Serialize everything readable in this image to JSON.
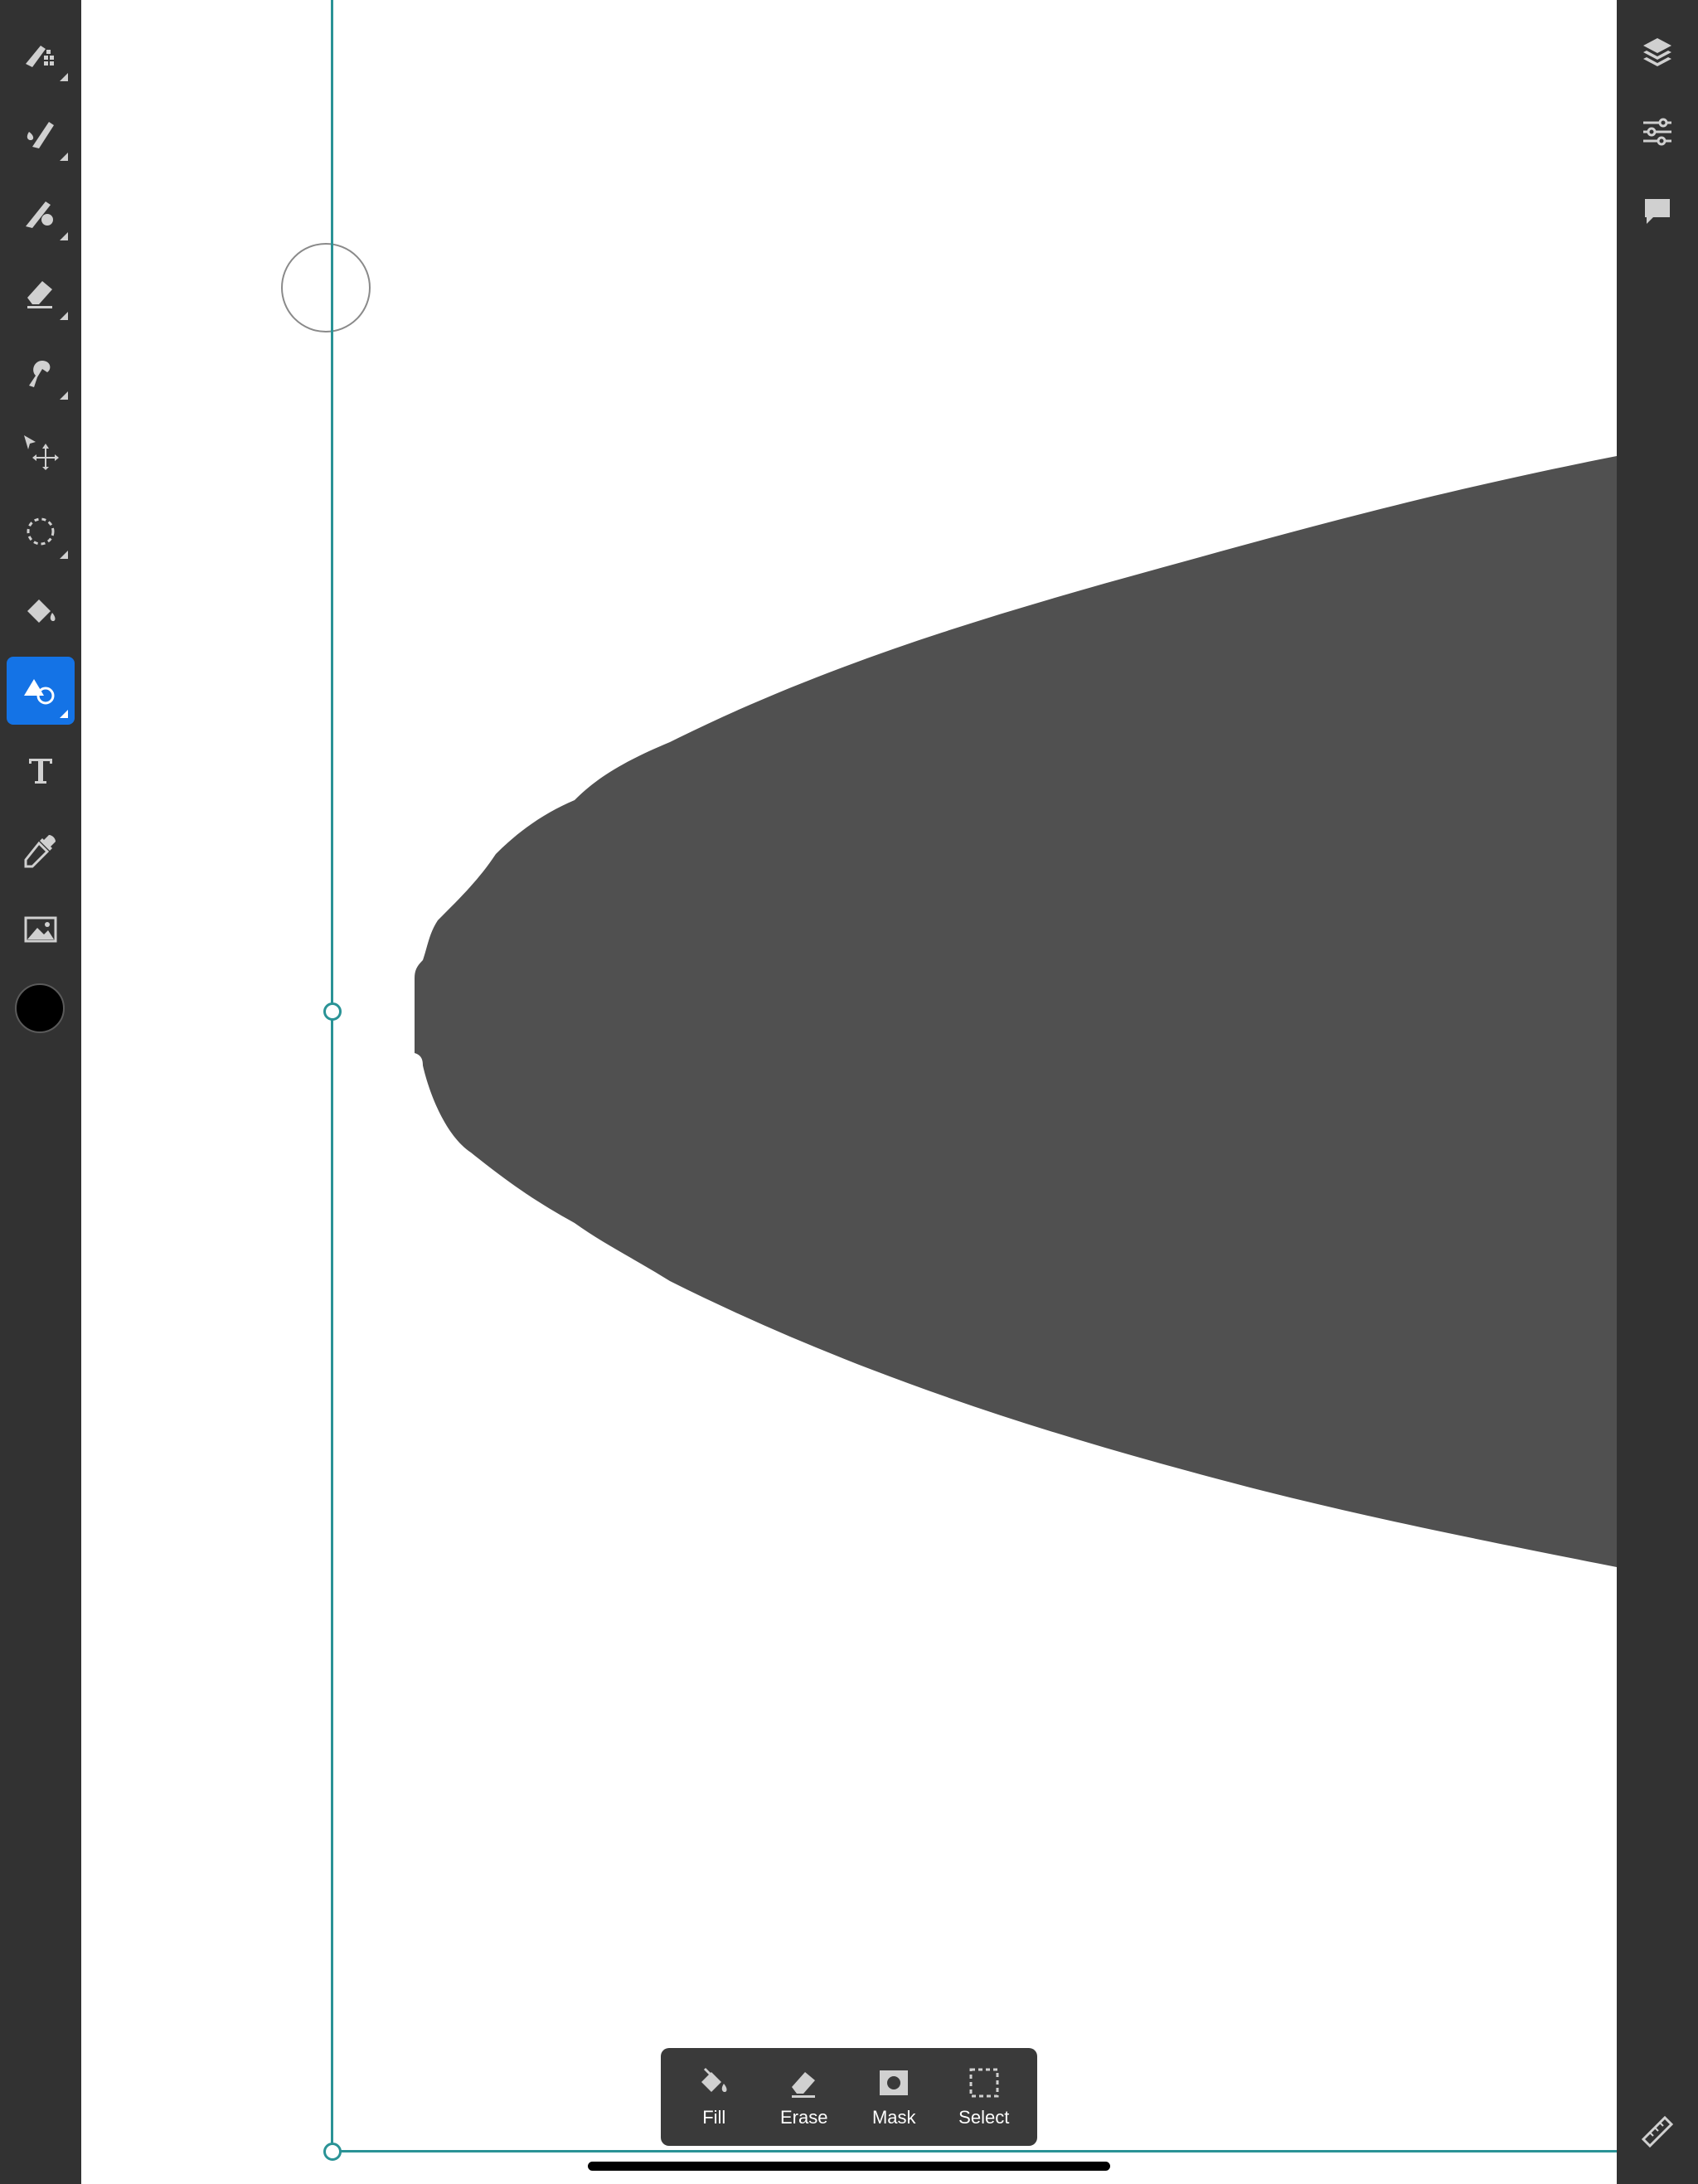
{
  "left_toolbar": {
    "tools": [
      {
        "name": "pixel-brush-icon",
        "active": false
      },
      {
        "name": "live-brush-icon",
        "active": false
      },
      {
        "name": "mixer-brush-icon",
        "active": false
      },
      {
        "name": "eraser-icon",
        "active": false
      },
      {
        "name": "smudge-icon",
        "active": false
      },
      {
        "name": "transform-icon",
        "active": false
      },
      {
        "name": "lasso-select-icon",
        "active": false
      },
      {
        "name": "fill-bucket-icon",
        "active": false
      },
      {
        "name": "shapes-icon",
        "active": true
      },
      {
        "name": "text-icon",
        "active": false
      },
      {
        "name": "eyedropper-icon",
        "active": false
      },
      {
        "name": "image-icon",
        "active": false
      }
    ],
    "color_swatch": "#000000"
  },
  "right_toolbar": {
    "tools": [
      "layers-icon",
      "adjustments-icon",
      "comment-icon",
      "ruler-icon"
    ]
  },
  "canvas": {
    "background": "#ffffff",
    "shape_fill": "#505050",
    "guide_color": "#2a9396"
  },
  "action_bar": {
    "fill_label": "Fill",
    "erase_label": "Erase",
    "mask_label": "Mask",
    "select_label": "Select"
  }
}
